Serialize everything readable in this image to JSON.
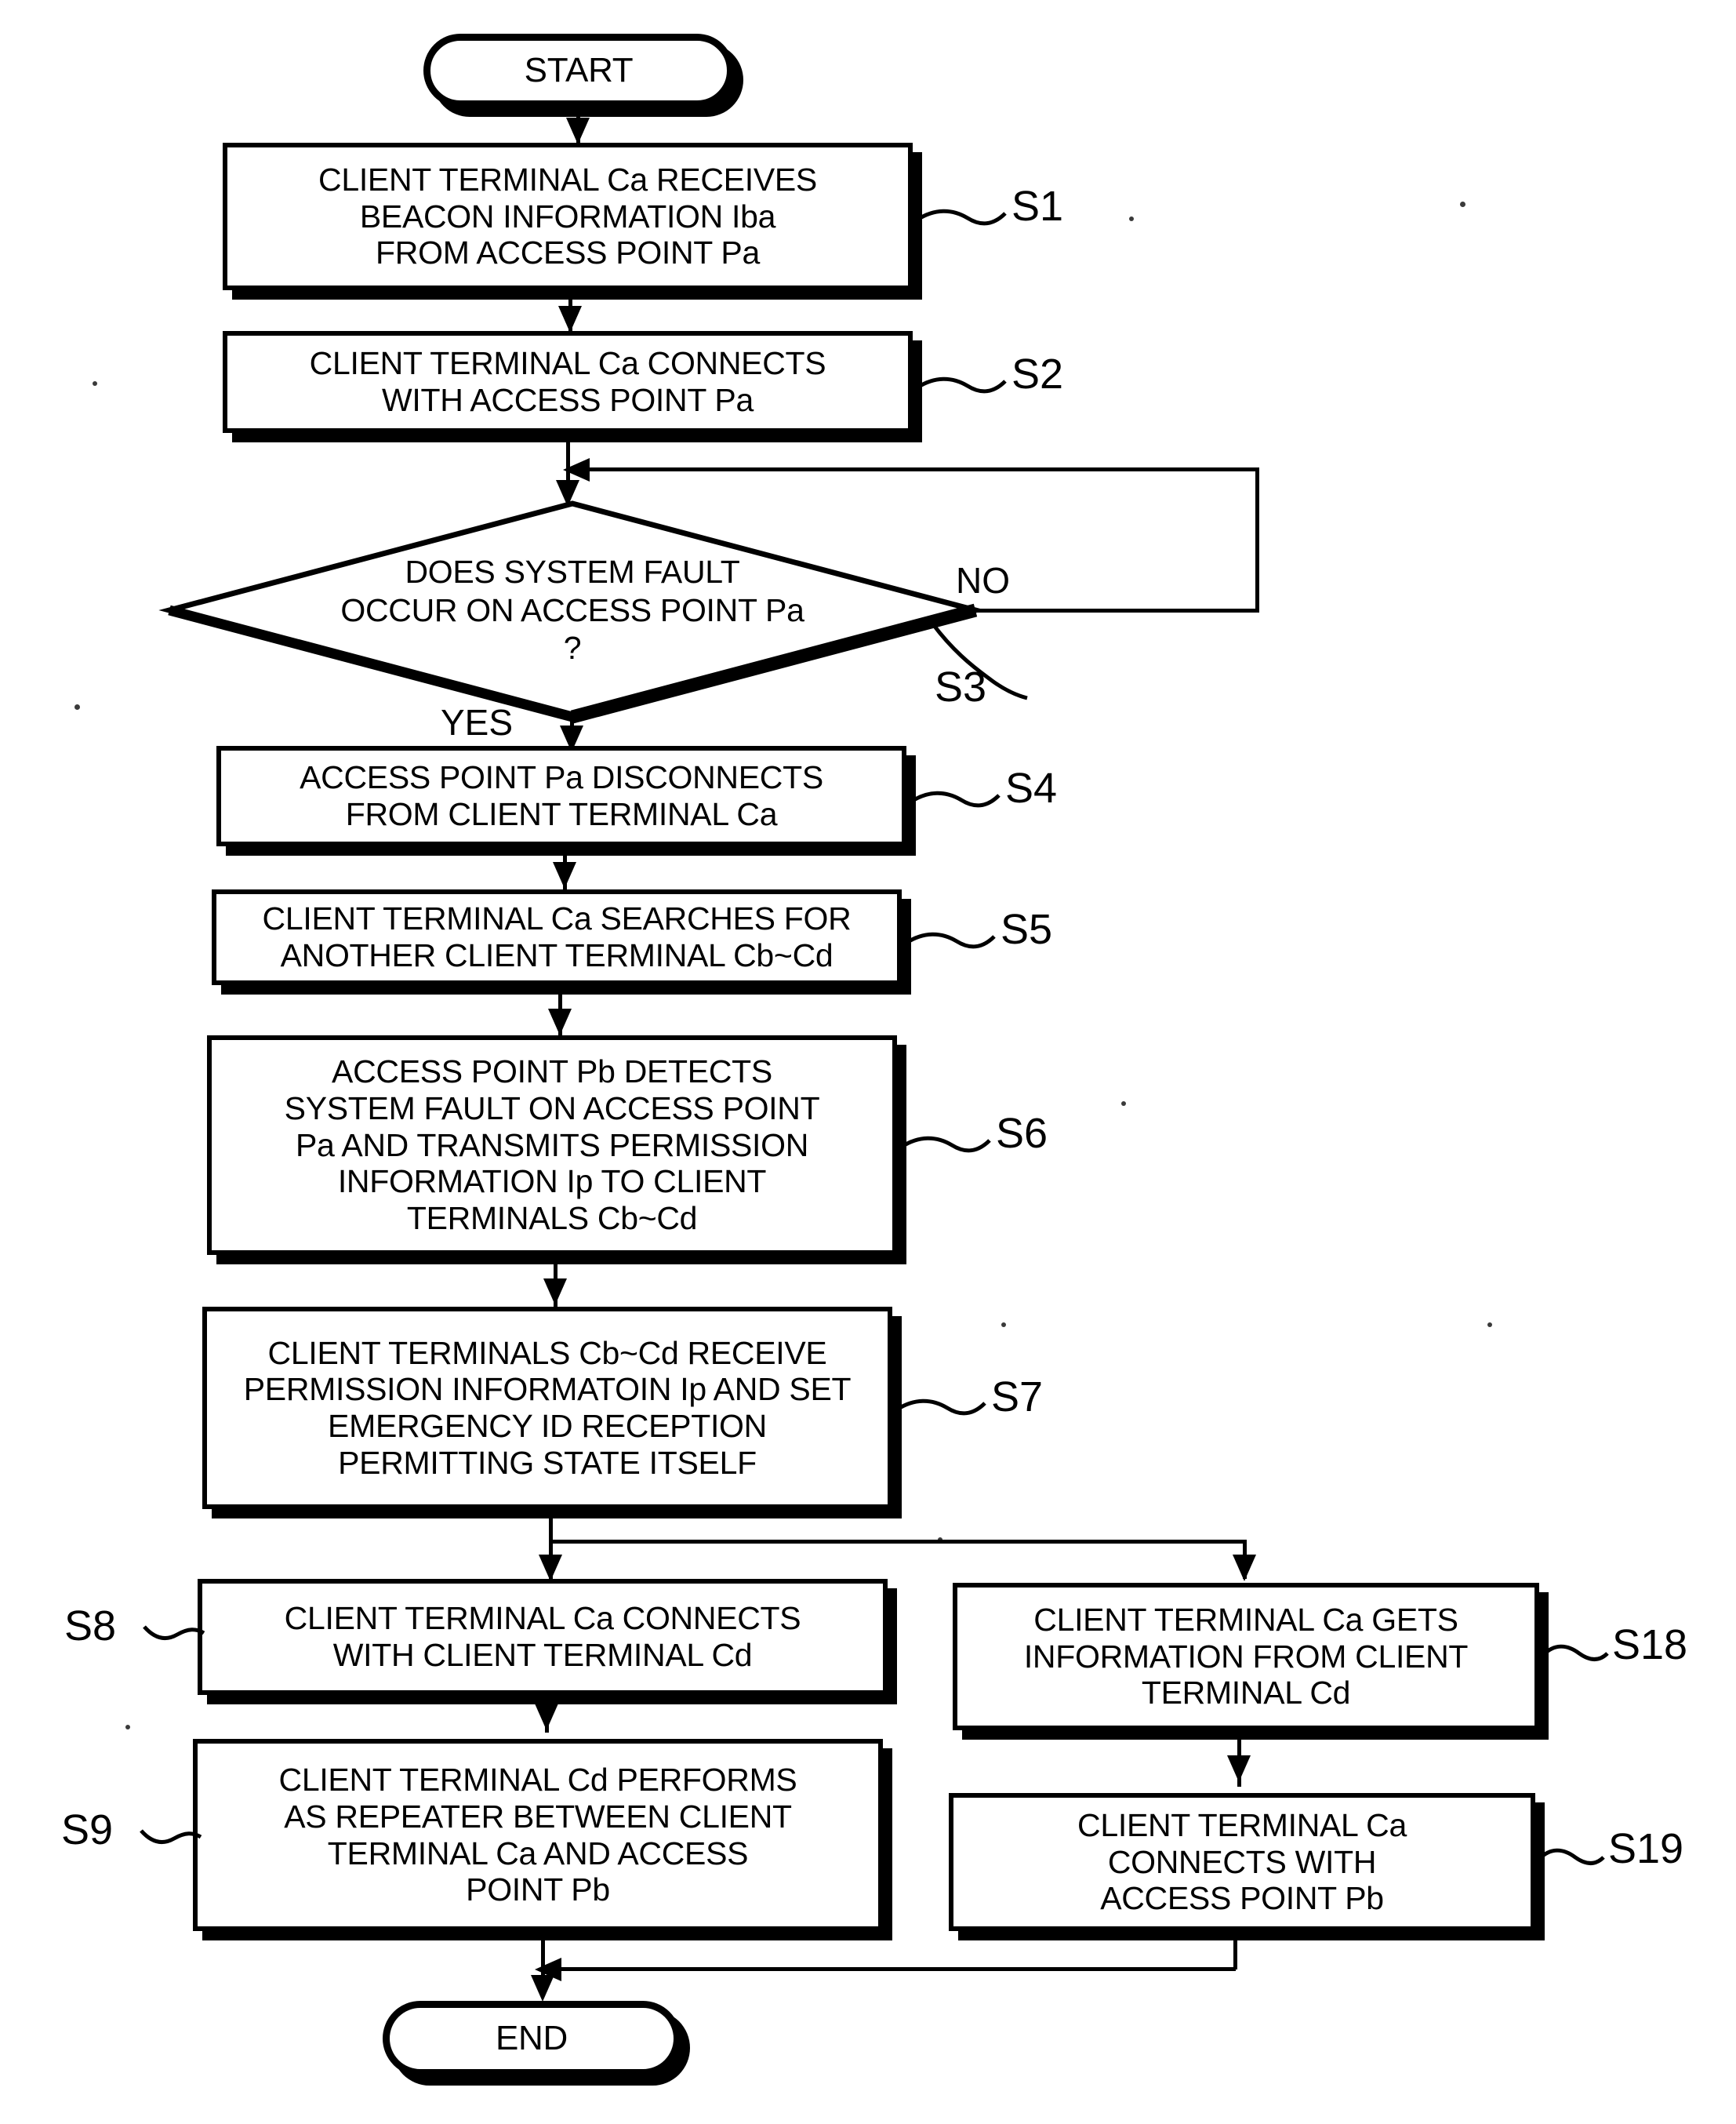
{
  "figure": {
    "type": "flowchart",
    "orientation": "vertical",
    "colors": {
      "stroke": "#000000",
      "fill": "#ffffff",
      "text": "#000000"
    }
  },
  "nodes": {
    "start": {
      "id": "start",
      "shape": "terminator",
      "label": "START"
    },
    "end": {
      "id": "end",
      "shape": "terminator",
      "label": "END"
    },
    "s1": {
      "step": "S1",
      "shape": "process",
      "label": "CLIENT TERMINAL Ca RECEIVES\nBEACON INFORMATION Iba\nFROM ACCESS POINT Pa"
    },
    "s2": {
      "step": "S2",
      "shape": "process",
      "label": "CLIENT TERMINAL Ca CONNECTS\nWITH ACCESS POINT Pa"
    },
    "s3": {
      "step": "S3",
      "shape": "decision",
      "label": "DOES SYSTEM FAULT\nOCCUR ON ACCESS POINT Pa\n?"
    },
    "s4": {
      "step": "S4",
      "shape": "process",
      "label": "ACCESS POINT Pa DISCONNECTS\nFROM CLIENT TERMINAL Ca"
    },
    "s5": {
      "step": "S5",
      "shape": "process",
      "label": "CLIENT TERMINAL Ca SEARCHES  FOR\nANOTHER CLIENT TERMINAL Cb~Cd"
    },
    "s6": {
      "step": "S6",
      "shape": "process",
      "label": "ACCESS POINT Pb DETECTS\nSYSTEM FAULT ON ACCESS POINT\nPa AND TRANSMITS PERMISSION\nINFORMATION Ip TO CLIENT\nTERMINALS Cb~Cd"
    },
    "s7": {
      "step": "S7",
      "shape": "process",
      "label": "CLIENT TERMINALS Cb~Cd RECEIVE\nPERMISSION INFORMATOIN Ip AND SET\nEMERGENCY ID RECEPTION\nPERMITTING STATE ITSELF"
    },
    "s8": {
      "step": "S8",
      "shape": "process",
      "label": "CLIENT TERMINAL Ca CONNECTS\nWITH CLIENT TERMINAL Cd"
    },
    "s9": {
      "step": "S9",
      "shape": "process",
      "label": "CLIENT TERMINAL Cd PERFORMS\nAS REPEATER BETWEEN CLIENT\nTERMINAL Ca AND ACCESS\nPOINT Pb"
    },
    "s18": {
      "step": "S18",
      "shape": "process",
      "label": "CLIENT TERMINAL Ca GETS\nINFORMATION FROM CLIENT\nTERMINAL Cd"
    },
    "s19": {
      "step": "S19",
      "shape": "process",
      "label": "CLIENT TERMINAL Ca\nCONNECTS WITH\nACCESS POINT Pb"
    }
  },
  "branches": {
    "yes": "YES",
    "no": "NO"
  },
  "step_labels": {
    "s1": "S1",
    "s2": "S2",
    "s3": "S3",
    "s4": "S4",
    "s5": "S5",
    "s6": "S6",
    "s7": "S7",
    "s8": "S8",
    "s9": "S9",
    "s18": "S18",
    "s19": "S19"
  },
  "edges": [
    {
      "from": "start",
      "to": "s1"
    },
    {
      "from": "s1",
      "to": "s2"
    },
    {
      "from": "s2",
      "to": "s3"
    },
    {
      "from": "s3",
      "to": "s4",
      "label": "YES"
    },
    {
      "from": "s3",
      "to": "s3",
      "label": "NO",
      "note": "loops back above decision"
    },
    {
      "from": "s4",
      "to": "s5"
    },
    {
      "from": "s5",
      "to": "s6"
    },
    {
      "from": "s6",
      "to": "s7"
    },
    {
      "from": "s7",
      "to": "s8"
    },
    {
      "from": "s7",
      "to": "s18"
    },
    {
      "from": "s8",
      "to": "s9"
    },
    {
      "from": "s18",
      "to": "s19"
    },
    {
      "from": "s9",
      "to": "end"
    },
    {
      "from": "s19",
      "to": "end"
    }
  ]
}
